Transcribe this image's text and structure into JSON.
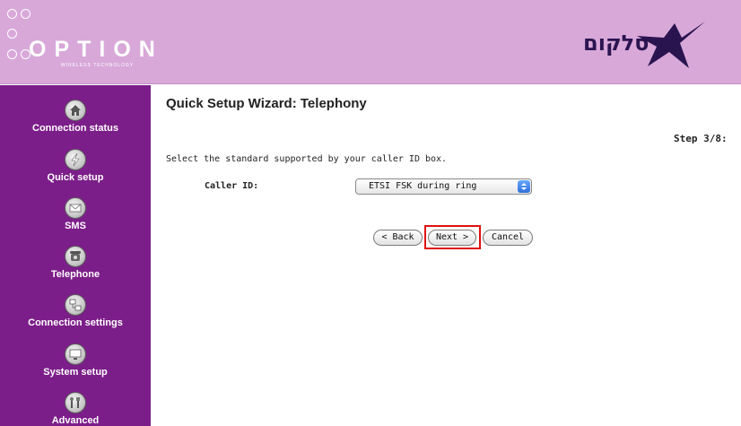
{
  "header": {
    "brand_left": "OPTION",
    "brand_left_sub": "WIRELESS TECHNOLOGY",
    "brand_right": "סלקום",
    "background_color": "#d8a8d9"
  },
  "sidebar": {
    "background_color": "#7c1e89",
    "items": [
      {
        "label": "Connection status",
        "icon": "home-icon"
      },
      {
        "label": "Quick setup",
        "icon": "lightning-icon"
      },
      {
        "label": "SMS",
        "icon": "envelope-icon"
      },
      {
        "label": "Telephone",
        "icon": "telephone-icon"
      },
      {
        "label": "Connection settings",
        "icon": "network-icon"
      },
      {
        "label": "System setup",
        "icon": "monitor-icon"
      },
      {
        "label": "Advanced",
        "icon": "tools-icon"
      }
    ]
  },
  "main": {
    "title": "Quick Setup Wizard: Telephony",
    "step": "Step 3/8:",
    "instruction": "Select the standard supported by your caller ID box.",
    "caller_id_label": "Caller ID:",
    "caller_id_value": "ETSI FSK during ring",
    "buttons": {
      "back": "< Back",
      "next": "Next >",
      "cancel": "Cancel"
    },
    "highlight_color": "#e01010"
  }
}
